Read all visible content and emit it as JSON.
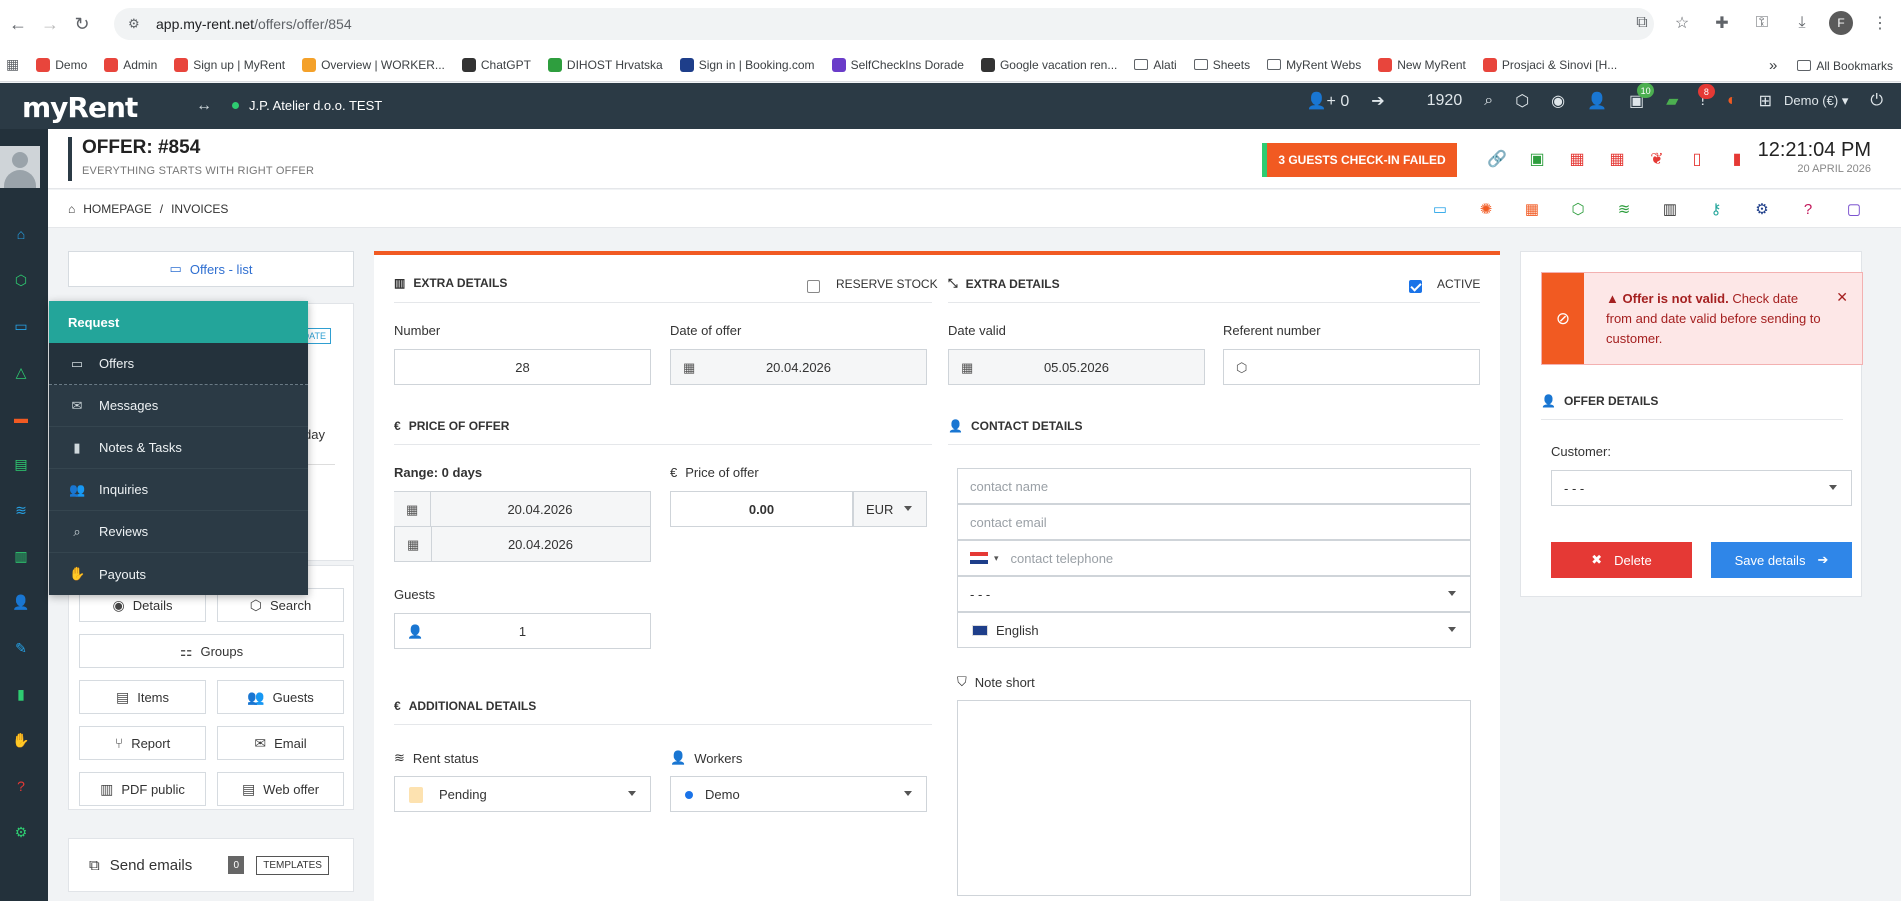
{
  "browser": {
    "url_host": "app.my-rent.net",
    "url_path": "/offers/offer/854",
    "profile_initial": "F",
    "bookmarks": [
      {
        "label": "Demo",
        "color": "#e8453c"
      },
      {
        "label": "Admin",
        "color": "#e8453c"
      },
      {
        "label": "Sign up | MyRent",
        "color": "#e8453c"
      },
      {
        "label": "Overview | WORKER...",
        "color": "#f4a12a"
      },
      {
        "label": "ChatGPT",
        "color": "#333333"
      },
      {
        "label": "DIHOST Hrvatska",
        "color": "#2e9e3e"
      },
      {
        "label": "Sign in | Booking.com",
        "color": "#1e3e8a"
      },
      {
        "label": "SelfCheckIns Dorade",
        "color": "#6a3cc9"
      },
      {
        "label": "Google vacation ren...",
        "color": "#333333"
      }
    ],
    "folders": [
      "Alati",
      "Sheets",
      "MyRent Webs"
    ],
    "bookmarks_after": [
      {
        "label": "New MyRent",
        "color": "#e8453c"
      },
      {
        "label": "Prosjaci & Sinovi [H...",
        "color": "#e8453c"
      }
    ],
    "all_bookmarks": "All Bookmarks",
    "more": "»"
  },
  "header": {
    "logo": "myRent",
    "company": "J.P. Atelier d.o.o. TEST",
    "guest_count": "0",
    "number": "1920",
    "badge_green": "10",
    "badge_red": "8",
    "account": "Demo (€)"
  },
  "page": {
    "title": "OFFER: #854",
    "subtitle": "EVERYTHING STARTS WITH RIGHT OFFER",
    "alert_button": "3 GUESTS CHECK-IN FAILED",
    "time": "12:21:04 PM",
    "date": "20 APRIL 2026",
    "breadcrumb": [
      "HOMEPAGE",
      "INVOICES"
    ],
    "breadcrumb_sep": "/"
  },
  "left": {
    "offers_list": "Offers - list",
    "date_tag": "DATE",
    "day": "day",
    "tiles": {
      "details": "Details",
      "search": "Search",
      "groups": "Groups",
      "items": "Items",
      "guests": "Guests",
      "report": "Report",
      "email": "Email",
      "pdf_public": "PDF public",
      "web_offer": "Web offer"
    },
    "send_emails": "Send emails",
    "send_count": "0",
    "templates": "TEMPLATES"
  },
  "menu": {
    "header": "Request",
    "items": [
      "Offers",
      "Messages",
      "Notes & Tasks",
      "Inquiries",
      "Reviews",
      "Payouts"
    ]
  },
  "form": {
    "extra_details_left": "EXTRA DETAILS",
    "reserve_stock": "RESERVE STOCK",
    "extra_details_right": "EXTRA DETAILS",
    "active": "ACTIVE",
    "number_label": "Number",
    "number_value": "28",
    "date_offer_label": "Date of offer",
    "date_offer_value": "20.04.2026",
    "date_valid_label": "Date valid",
    "date_valid_value": "05.05.2026",
    "referent_label": "Referent number",
    "price_section": "PRICE OF OFFER",
    "range_label": "Range: 0 days",
    "range_from": "20.04.2026",
    "range_to": "20.04.2026",
    "price_label": "Price of offer",
    "price_value": "0.00",
    "currency": "EUR",
    "guests_label": "Guests",
    "guests_value": "1",
    "contact_section": "CONTACT DETAILS",
    "contact_name_ph": "contact name",
    "contact_email_ph": "contact email",
    "contact_phone_ph": "contact telephone",
    "select_blank": "- - -",
    "language": "English",
    "note_label": "Note short",
    "additional_section": "ADDITIONAL DETAILS",
    "rent_status_label": "Rent status",
    "rent_status_value": "Pending",
    "workers_label": "Workers",
    "workers_value": "Demo"
  },
  "right": {
    "alert_bold": "Offer is not valid.",
    "alert_text": "Check date from and date valid before sending to customer.",
    "offer_details": "OFFER DETAILS",
    "customer_label": "Customer:",
    "customer_value": "- - -",
    "delete": "Delete",
    "save": "Save details"
  },
  "colors": {
    "accent_orange": "#f15a22",
    "teal": "#23a59a",
    "dark": "#2b3a45",
    "blue": "#2f86e8",
    "red": "#e53935"
  }
}
